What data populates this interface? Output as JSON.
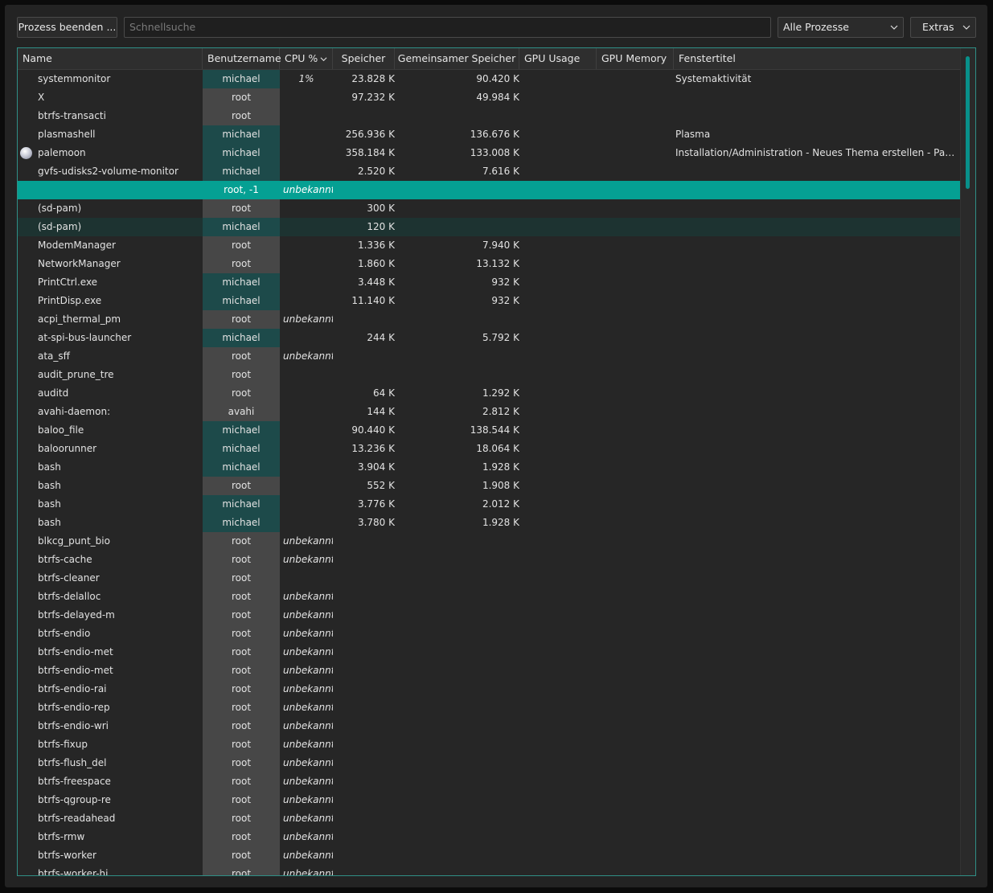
{
  "toolbar": {
    "kill_label": "Prozess beenden ...",
    "search_placeholder": "Schnellsuche",
    "filter_value": "Alle Prozesse",
    "extras_label": "Extras"
  },
  "columns": {
    "name": "Name",
    "user": "Benutzername",
    "cpu": "CPU %",
    "memory": "Speicher",
    "shared": "Gemeinsamer Speicher",
    "gpu_usage": "GPU Usage",
    "gpu_memory": "GPU Memory",
    "window_title": "Fenstertitel"
  },
  "colors": {
    "accent": "#05a093",
    "frame": "#2f8f86",
    "user_michael": "#1d4a4a",
    "user_root": "#474747"
  },
  "rows": [
    {
      "name": "systemmonitor",
      "user": "michael",
      "cpu": "1%",
      "mem": "23.828 K",
      "shared": "90.420 K",
      "title": "Systemaktivität"
    },
    {
      "name": "X",
      "user": "root",
      "cpu": "",
      "mem": "97.232 K",
      "shared": "49.984 K",
      "title": ""
    },
    {
      "name": "btrfs-transacti",
      "user": "root",
      "cpu": "",
      "mem": "",
      "shared": "",
      "title": ""
    },
    {
      "name": "plasmashell",
      "user": "michael",
      "cpu": "",
      "mem": "256.936 K",
      "shared": "136.676 K",
      "title": "Plasma"
    },
    {
      "name": "palemoon",
      "user": "michael",
      "cpu": "",
      "mem": "358.184 K",
      "shared": "133.008 K",
      "title": "Installation/Administration - Neues Thema erstellen - Pale M...",
      "icon": "palemoon-icon"
    },
    {
      "name": "gvfs-udisks2-volume-monitor",
      "user": "michael",
      "cpu": "",
      "mem": "2.520 K",
      "shared": "7.616 K",
      "title": ""
    },
    {
      "name": "",
      "user": "root, -1",
      "cpu": "unbekannt",
      "mem": "",
      "shared": "",
      "title": "",
      "state": "selected"
    },
    {
      "name": "(sd-pam)",
      "user": "root",
      "cpu": "",
      "mem": "300 K",
      "shared": "",
      "title": ""
    },
    {
      "name": "(sd-pam)",
      "user": "michael",
      "cpu": "",
      "mem": "120 K",
      "shared": "",
      "title": "",
      "state": "hover"
    },
    {
      "name": "ModemManager",
      "user": "root",
      "cpu": "",
      "mem": "1.336 K",
      "shared": "7.940 K",
      "title": ""
    },
    {
      "name": "NetworkManager",
      "user": "root",
      "cpu": "",
      "mem": "1.860 K",
      "shared": "13.132 K",
      "title": ""
    },
    {
      "name": "PrintCtrl.exe",
      "user": "michael",
      "cpu": "",
      "mem": "3.448 K",
      "shared": "932 K",
      "title": ""
    },
    {
      "name": "PrintDisp.exe",
      "user": "michael",
      "cpu": "",
      "mem": "11.140 K",
      "shared": "932 K",
      "title": ""
    },
    {
      "name": "acpi_thermal_pm",
      "user": "root",
      "cpu": "unbekannt",
      "mem": "",
      "shared": "",
      "title": ""
    },
    {
      "name": "at-spi-bus-launcher",
      "user": "michael",
      "cpu": "",
      "mem": "244 K",
      "shared": "5.792 K",
      "title": ""
    },
    {
      "name": "ata_sff",
      "user": "root",
      "cpu": "unbekannt",
      "mem": "",
      "shared": "",
      "title": ""
    },
    {
      "name": "audit_prune_tre",
      "user": "root",
      "cpu": "",
      "mem": "",
      "shared": "",
      "title": ""
    },
    {
      "name": "auditd",
      "user": "root",
      "cpu": "",
      "mem": "64 K",
      "shared": "1.292 K",
      "title": ""
    },
    {
      "name": "avahi-daemon:",
      "user": "avahi",
      "cpu": "",
      "mem": "144 K",
      "shared": "2.812 K",
      "title": ""
    },
    {
      "name": "baloo_file",
      "user": "michael",
      "cpu": "",
      "mem": "90.440 K",
      "shared": "138.544 K",
      "title": ""
    },
    {
      "name": "baloorunner",
      "user": "michael",
      "cpu": "",
      "mem": "13.236 K",
      "shared": "18.064 K",
      "title": ""
    },
    {
      "name": "bash",
      "user": "michael",
      "cpu": "",
      "mem": "3.904 K",
      "shared": "1.928 K",
      "title": ""
    },
    {
      "name": "bash",
      "user": "root",
      "cpu": "",
      "mem": "552 K",
      "shared": "1.908 K",
      "title": ""
    },
    {
      "name": "bash",
      "user": "michael",
      "cpu": "",
      "mem": "3.776 K",
      "shared": "2.012 K",
      "title": ""
    },
    {
      "name": "bash",
      "user": "michael",
      "cpu": "",
      "mem": "3.780 K",
      "shared": "1.928 K",
      "title": ""
    },
    {
      "name": "blkcg_punt_bio",
      "user": "root",
      "cpu": "unbekannt",
      "mem": "",
      "shared": "",
      "title": ""
    },
    {
      "name": "btrfs-cache",
      "user": "root",
      "cpu": "unbekannt",
      "mem": "",
      "shared": "",
      "title": ""
    },
    {
      "name": "btrfs-cleaner",
      "user": "root",
      "cpu": "",
      "mem": "",
      "shared": "",
      "title": ""
    },
    {
      "name": "btrfs-delalloc",
      "user": "root",
      "cpu": "unbekannt",
      "mem": "",
      "shared": "",
      "title": ""
    },
    {
      "name": "btrfs-delayed-m",
      "user": "root",
      "cpu": "unbekannt",
      "mem": "",
      "shared": "",
      "title": ""
    },
    {
      "name": "btrfs-endio",
      "user": "root",
      "cpu": "unbekannt",
      "mem": "",
      "shared": "",
      "title": ""
    },
    {
      "name": "btrfs-endio-met",
      "user": "root",
      "cpu": "unbekannt",
      "mem": "",
      "shared": "",
      "title": ""
    },
    {
      "name": "btrfs-endio-met",
      "user": "root",
      "cpu": "unbekannt",
      "mem": "",
      "shared": "",
      "title": ""
    },
    {
      "name": "btrfs-endio-rai",
      "user": "root",
      "cpu": "unbekannt",
      "mem": "",
      "shared": "",
      "title": ""
    },
    {
      "name": "btrfs-endio-rep",
      "user": "root",
      "cpu": "unbekannt",
      "mem": "",
      "shared": "",
      "title": ""
    },
    {
      "name": "btrfs-endio-wri",
      "user": "root",
      "cpu": "unbekannt",
      "mem": "",
      "shared": "",
      "title": ""
    },
    {
      "name": "btrfs-fixup",
      "user": "root",
      "cpu": "unbekannt",
      "mem": "",
      "shared": "",
      "title": ""
    },
    {
      "name": "btrfs-flush_del",
      "user": "root",
      "cpu": "unbekannt",
      "mem": "",
      "shared": "",
      "title": ""
    },
    {
      "name": "btrfs-freespace",
      "user": "root",
      "cpu": "unbekannt",
      "mem": "",
      "shared": "",
      "title": ""
    },
    {
      "name": "btrfs-qgroup-re",
      "user": "root",
      "cpu": "unbekannt",
      "mem": "",
      "shared": "",
      "title": ""
    },
    {
      "name": "btrfs-readahead",
      "user": "root",
      "cpu": "unbekannt",
      "mem": "",
      "shared": "",
      "title": ""
    },
    {
      "name": "btrfs-rmw",
      "user": "root",
      "cpu": "unbekannt",
      "mem": "",
      "shared": "",
      "title": ""
    },
    {
      "name": "btrfs-worker",
      "user": "root",
      "cpu": "unbekannt",
      "mem": "",
      "shared": "",
      "title": ""
    },
    {
      "name": "btrfs-worker-hi",
      "user": "root",
      "cpu": "unbekannt",
      "mem": "",
      "shared": "",
      "title": ""
    }
  ]
}
